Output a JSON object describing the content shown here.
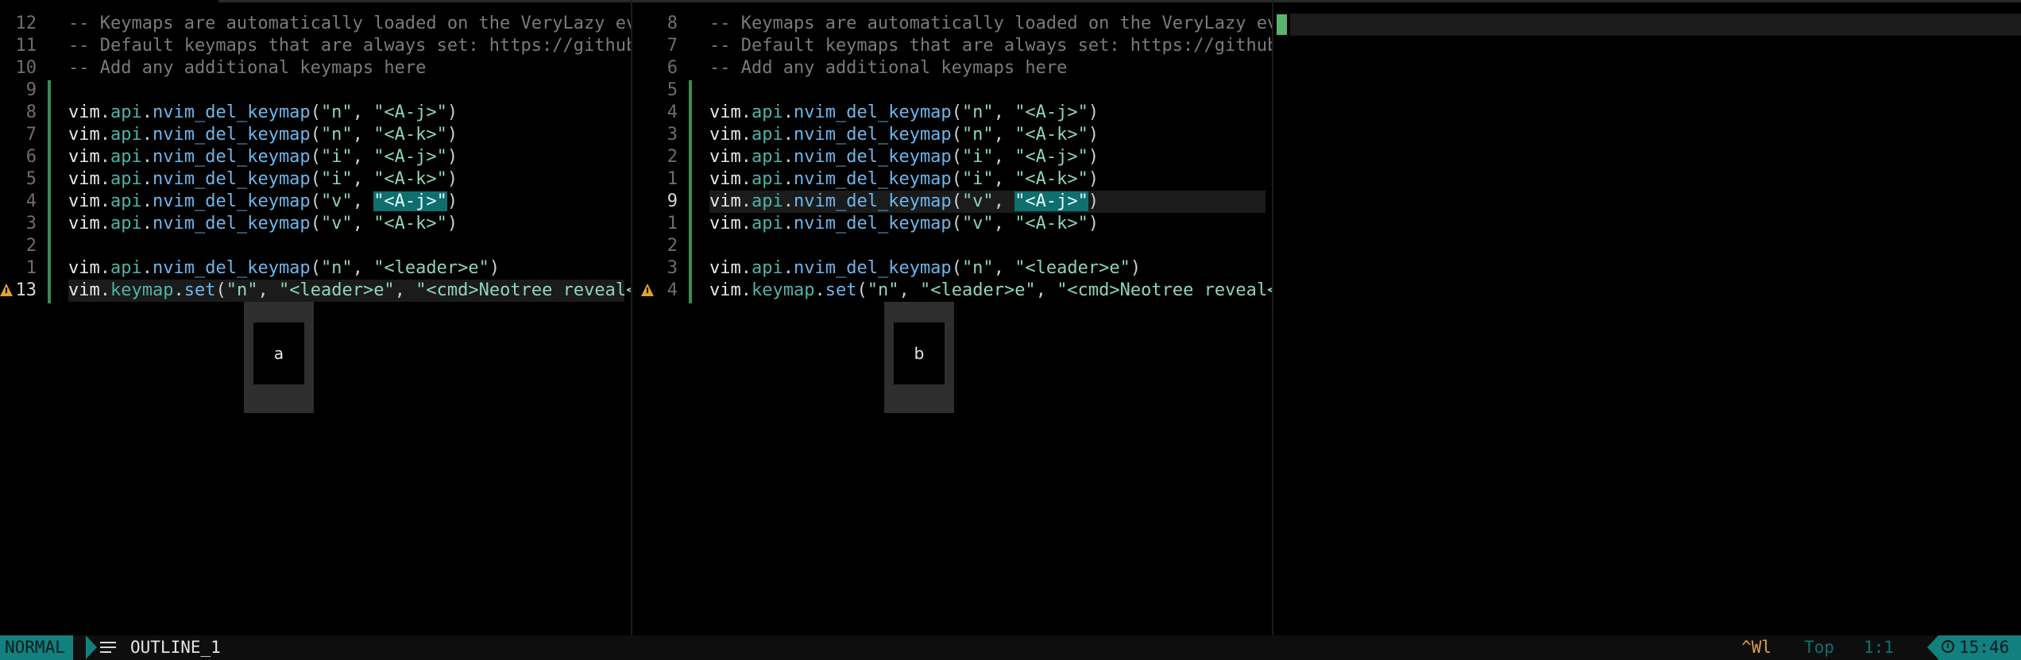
{
  "windows": [
    {
      "id": "a",
      "label": "a",
      "lines": [
        {
          "num": "12",
          "kind": "comment",
          "text": "-- Keymaps are automatically loaded on the VeryLazy ev"
        },
        {
          "num": "11",
          "kind": "comment",
          "text": "-- Default keymaps that are always set: https://github"
        },
        {
          "num": "10",
          "kind": "comment",
          "text": "-- Add any additional keymaps here"
        },
        {
          "num": "9",
          "kind": "empty"
        },
        {
          "num": "8",
          "kind": "del",
          "mode": "\"n\"",
          "key": "\"<A-j>\""
        },
        {
          "num": "7",
          "kind": "del",
          "mode": "\"n\"",
          "key": "\"<A-k>\""
        },
        {
          "num": "6",
          "kind": "del",
          "mode": "\"i\"",
          "key": "\"<A-j>\""
        },
        {
          "num": "5",
          "kind": "del",
          "mode": "\"i\"",
          "key": "\"<A-k>\""
        },
        {
          "num": "4",
          "kind": "del",
          "mode": "\"v\"",
          "key": "\"<A-j>\"",
          "search": true
        },
        {
          "num": "3",
          "kind": "del",
          "mode": "\"v\"",
          "key": "\"<A-k>\""
        },
        {
          "num": "2",
          "kind": "empty"
        },
        {
          "num": "1",
          "kind": "del",
          "mode": "\"n\"",
          "key": "\"<leader>e\""
        },
        {
          "num": "13",
          "kind": "set",
          "mode": "\"n\"",
          "key": "\"<leader>e\"",
          "rhs": "\"<cmd>Neotree reveal<",
          "warn": true,
          "current": true
        }
      ]
    },
    {
      "id": "b",
      "label": "b",
      "lines": [
        {
          "num": "8",
          "kind": "comment",
          "text": "-- Keymaps are automatically loaded on the VeryLazy ev"
        },
        {
          "num": "7",
          "kind": "comment",
          "text": "-- Default keymaps that are always set: https://github"
        },
        {
          "num": "6",
          "kind": "comment",
          "text": "-- Add any additional keymaps here"
        },
        {
          "num": "5",
          "kind": "empty"
        },
        {
          "num": "4",
          "kind": "del",
          "mode": "\"n\"",
          "key": "\"<A-j>\""
        },
        {
          "num": "3",
          "kind": "del",
          "mode": "\"n\"",
          "key": "\"<A-k>\""
        },
        {
          "num": "2",
          "kind": "del",
          "mode": "\"i\"",
          "key": "\"<A-j>\""
        },
        {
          "num": "1",
          "kind": "del",
          "mode": "\"i\"",
          "key": "\"<A-k>\""
        },
        {
          "num": "9",
          "kind": "del",
          "mode": "\"v\"",
          "key": "\"<A-j>\"",
          "search": true,
          "current": true
        },
        {
          "num": "1",
          "kind": "del",
          "mode": "\"v\"",
          "key": "\"<A-k>\""
        },
        {
          "num": "2",
          "kind": "empty"
        },
        {
          "num": "3",
          "kind": "del",
          "mode": "\"n\"",
          "key": "\"<leader>e\""
        },
        {
          "num": "4",
          "kind": "set",
          "mode": "\"n\"",
          "key": "\"<leader>e\"",
          "rhs": "\"<cmd>Neotree reveal<",
          "warn": true
        }
      ]
    }
  ],
  "tokens": {
    "vim": "vim",
    "api": "api",
    "del_fn": "nvim_del_keymap",
    "keymap": "keymap",
    "set_fn": "set",
    "dot": ".",
    "comma": ", ",
    "open": "(",
    "close": ")"
  },
  "statusline": {
    "mode": "NORMAL",
    "icon": "outline-icon",
    "filename": "OUTLINE_1",
    "keys": "^Wl",
    "position_text": "Top",
    "row_col": "1:1",
    "clock_icon": "clock-icon",
    "time": "15:46"
  },
  "colors": {
    "accent": "#12807f",
    "git_added": "#3f8a52",
    "warning": "#e0a030",
    "search_highlight": "#0f6e6e"
  }
}
